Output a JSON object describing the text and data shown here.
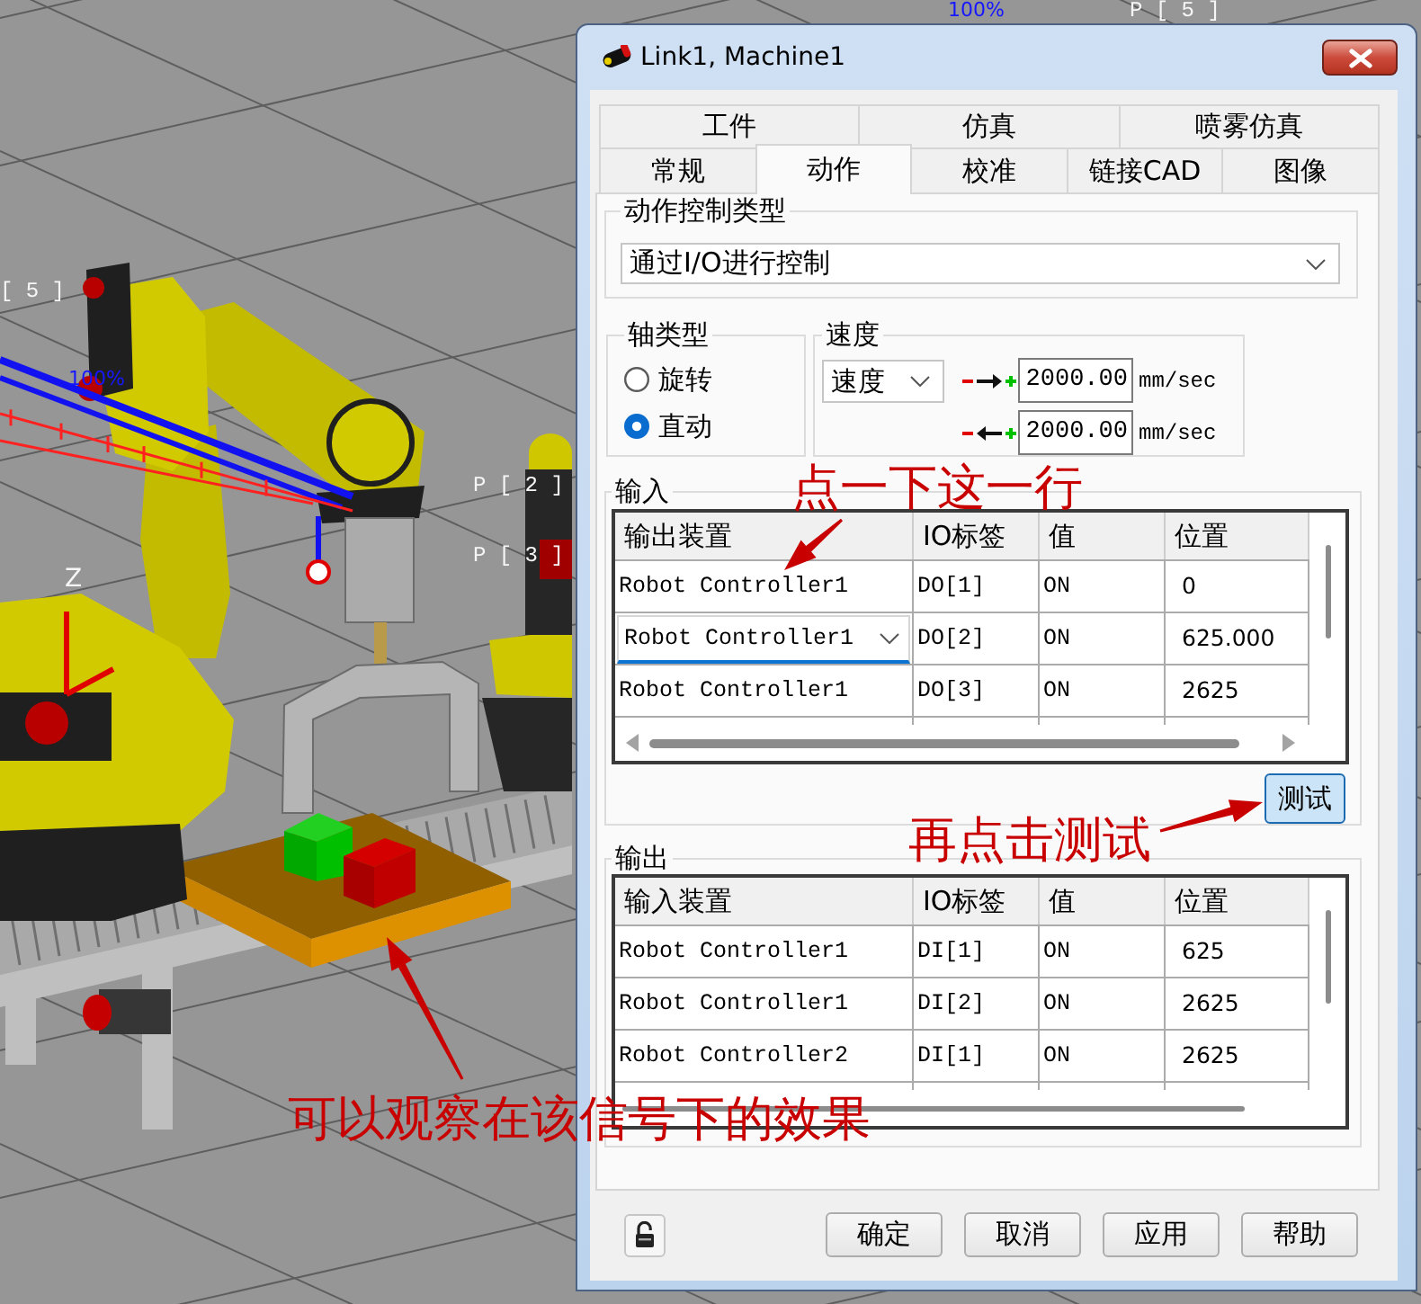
{
  "viewport": {
    "point_labels": [
      "P [ 5 ]",
      "[ 5 ]",
      "P [ 2 ]",
      "P [ 3 ]"
    ],
    "axis_label": "Z",
    "speed_labels": [
      "100%",
      "100%"
    ]
  },
  "dialog": {
    "title": "Link1, Machine1",
    "tab_rows": [
      {
        "tabs": [
          {
            "label": "工件",
            "selected": false
          },
          {
            "label": "仿真",
            "selected": false
          },
          {
            "label": "喷雾仿真",
            "selected": false
          }
        ]
      },
      {
        "tabs": [
          {
            "label": "常规",
            "selected": false
          },
          {
            "label": "动作",
            "selected": true
          },
          {
            "label": "校准",
            "selected": false
          },
          {
            "label": "链接CAD",
            "selected": false
          },
          {
            "label": "图像",
            "selected": false
          }
        ]
      }
    ],
    "motion_control": {
      "label": "动作控制类型",
      "value": "通过I/O进行控制"
    },
    "axis_type": {
      "label": "轴类型",
      "options": [
        {
          "label": "旋转",
          "selected": false
        },
        {
          "label": "直动",
          "selected": true
        }
      ]
    },
    "speed": {
      "label": "速度",
      "mode": "速度",
      "rows": [
        {
          "kind": "forward",
          "value": "2000.00",
          "unit": "mm/sec"
        },
        {
          "kind": "backward",
          "value": "2000.00",
          "unit": "mm/sec"
        }
      ]
    },
    "input": {
      "label": "输入",
      "columns": [
        "输出装置",
        "IO标签",
        "值",
        "位置"
      ],
      "rows": [
        {
          "selected": false,
          "cells": [
            "Robot Controller1",
            "DO[1]",
            "ON",
            "0"
          ]
        },
        {
          "selected": true,
          "cells": [
            "Robot Controller1",
            "DO[2]",
            "ON",
            "625.000"
          ]
        },
        {
          "selected": false,
          "cells": [
            "Robot Controller1",
            "DO[3]",
            "ON",
            "2625"
          ]
        }
      ],
      "scrollbar_hovered": true,
      "test_button": "测试"
    },
    "output": {
      "label": "输出",
      "columns": [
        "输入装置",
        "IO标签",
        "值",
        "位置"
      ],
      "rows": [
        {
          "selected": false,
          "cells": [
            "Robot Controller1",
            "DI[1]",
            "ON",
            "625"
          ]
        },
        {
          "selected": false,
          "cells": [
            "Robot Controller1",
            "DI[2]",
            "ON",
            "2625"
          ]
        },
        {
          "selected": false,
          "cells": [
            "Robot Controller2",
            "DI[1]",
            "ON",
            "2625"
          ]
        }
      ],
      "scrollbar_hovered": false
    },
    "buttons": [
      "确定",
      "取消",
      "应用",
      "帮助"
    ]
  },
  "annotations": [
    "点一下这一行",
    "再点击测试",
    "可以观察在该信号下的效果"
  ]
}
